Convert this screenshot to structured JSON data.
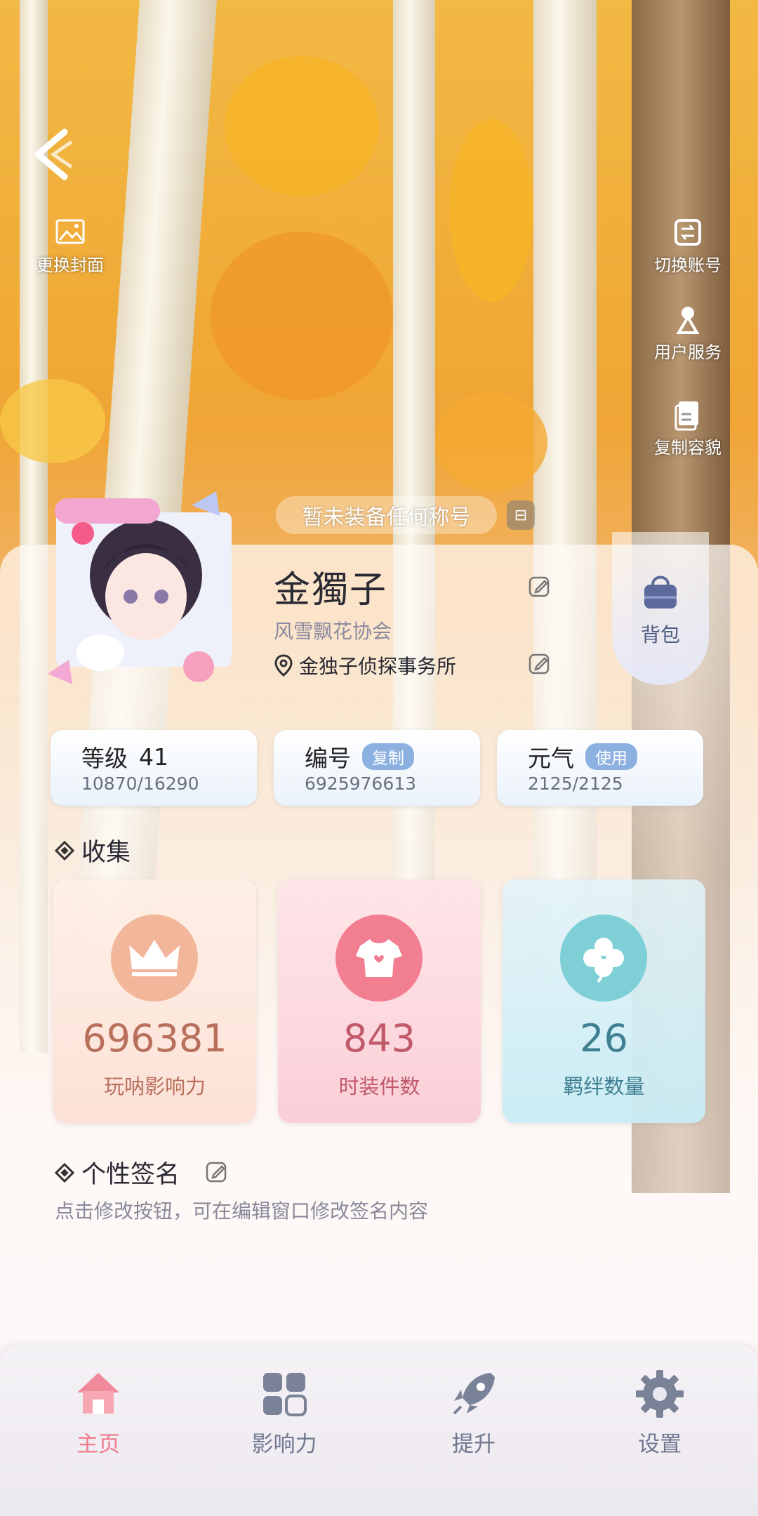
{
  "header": {
    "back_icon": "chevron-left-icon",
    "change_cover_label": "更换封面",
    "switch_account_label": "切换账号",
    "user_service_label": "用户服务",
    "copy_appearance_label": "复制容貌"
  },
  "title_pill": {
    "text": "暂未装备任何称号",
    "tag": "⊟"
  },
  "profile": {
    "name": "金獨子",
    "guild": "风雪飘花协会",
    "office": "金独子侦探事务所",
    "bag_label": "背包"
  },
  "stats": {
    "level": {
      "label": "等级",
      "value_num": "41",
      "progress": "10870/16290"
    },
    "id": {
      "label": "编号",
      "badge": "复制",
      "value": "6925976613"
    },
    "energy": {
      "label": "元气",
      "badge": "使用",
      "value": "2125/2125"
    }
  },
  "collection": {
    "title": "收集",
    "cards": [
      {
        "value": "696381",
        "label": "玩呐影响力",
        "icon": "crown-icon",
        "color": "#b8705c"
      },
      {
        "value": "843",
        "label": "时装件数",
        "icon": "shirt-icon",
        "color": "#c05a6a"
      },
      {
        "value": "26",
        "label": "羁绊数量",
        "icon": "clover-icon",
        "color": "#3f7f92"
      }
    ]
  },
  "signature": {
    "title": "个性签名",
    "hint": "点击修改按钮，可在编辑窗口修改签名内容"
  },
  "nav": [
    {
      "label": "主页",
      "icon": "home-icon",
      "active": true
    },
    {
      "label": "影响力",
      "icon": "grid-icon",
      "active": false
    },
    {
      "label": "提升",
      "icon": "rocket-icon",
      "active": false
    },
    {
      "label": "设置",
      "icon": "gear-icon",
      "active": false
    }
  ]
}
